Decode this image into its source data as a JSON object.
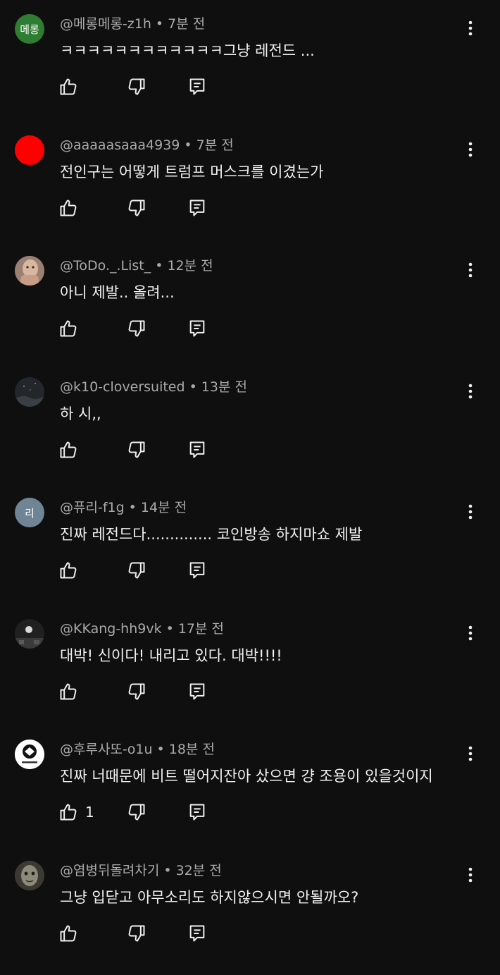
{
  "colors": {
    "background": "#0f0f0f",
    "text": "#f1f1f1",
    "meta": "#aaaaaa"
  },
  "comments": [
    {
      "avatar": {
        "kind": "text",
        "text": "메롱",
        "bg": "#2e7d32",
        "alt": "avatar"
      },
      "author": "@메롱메롱-z1h",
      "time": "7분 전",
      "text": "ㅋㅋㅋㅋㅋㅋㅋㅋㅋㅋㅋㅋ그냥 레전드 ...",
      "likes": ""
    },
    {
      "avatar": {
        "kind": "color",
        "text": "",
        "bg": "#ff0000"
      },
      "author": "@aaaaasaaa4939",
      "time": "7분 전",
      "text": "전인구는 어떻게 트럼프 머스크를 이겼는가",
      "likes": ""
    },
    {
      "avatar": {
        "kind": "photo-figure",
        "text": "",
        "bg": "#8a6f61"
      },
      "author": "@ToDo._.List_",
      "time": "12분 전",
      "text": "아니 제발.. 올려...",
      "likes": ""
    },
    {
      "avatar": {
        "kind": "photo-dark",
        "text": "",
        "bg": "#1f2226"
      },
      "author": "@k10-cloversuited",
      "time": "13분 전",
      "text": "하 시,,",
      "likes": ""
    },
    {
      "avatar": {
        "kind": "text",
        "text": "리",
        "bg": "#6f8494"
      },
      "author": "@퓨리-f1g",
      "time": "14분 전",
      "text": "진짜 레전드다.............. 코인방송 하지마쇼 제발",
      "likes": ""
    },
    {
      "avatar": {
        "kind": "photo-night",
        "text": "",
        "bg": "#191919"
      },
      "author": "@KKang-hh9vk",
      "time": "17분 전",
      "text": "대박! 신이다! 내리고 있다. 대박!!!!",
      "likes": ""
    },
    {
      "avatar": {
        "kind": "photo-logo",
        "text": "",
        "bg": "#ffffff"
      },
      "author": "@후루사또-o1u",
      "time": "18분 전",
      "text": "진짜 너때문에 비트 떨어지잔아 샀으면 걍 조용이 있을것이지",
      "likes": "1"
    },
    {
      "avatar": {
        "kind": "photo-face",
        "text": "",
        "bg": "#4a4a40"
      },
      "author": "@염병뒤돌려차기",
      "time": "32분 전",
      "text": "그냥 입닫고 아무소리도 하지않으시면 안될까오?",
      "likes": ""
    }
  ]
}
